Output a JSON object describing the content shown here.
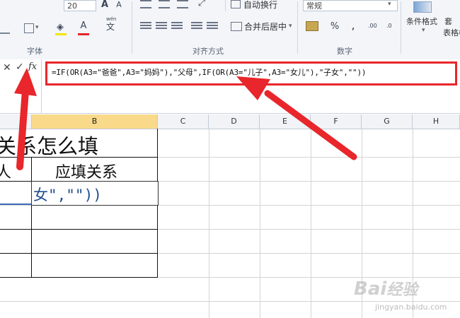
{
  "ribbon": {
    "font_size": "20",
    "bold_glyph": "A",
    "font_color_glyph": "A",
    "wen_glyph": "wén",
    "wrap_text": "自动换行",
    "merge_center": "合并后居中",
    "number_format": "常规",
    "percent": "%",
    "comma": ",",
    "inc_decimal": ".00",
    "dec_decimal": ".0",
    "conditional_format": "条件格式",
    "table_format": "表格样",
    "group_font": "字体",
    "group_align": "对齐方式",
    "group_number": "数字"
  },
  "formula_bar": {
    "cancel": "✕",
    "enter": "✓",
    "fx": "fx",
    "formula": "=IF(OR(A3=\"爸爸\",A3=\"妈妈\"),\"父母\",IF(OR(A3=\"儿子\",A3=\"女儿\"),\"子女\",\"\"))"
  },
  "columns": [
    "B",
    "C",
    "D",
    "E",
    "F",
    "G",
    "H"
  ],
  "sheet": {
    "title_partial": "关系怎么填",
    "header_a_partial": "人",
    "header_b": "应填关系",
    "edit_partial": "女\",\"\"))"
  },
  "watermark": {
    "brand": "Bai",
    "brand2": "经验",
    "url": "jingyan.baidu.com"
  },
  "colors": {
    "accent_red": "#e8262b",
    "selected_col": "#f9d98a",
    "edit_text": "#1f4e8c"
  }
}
